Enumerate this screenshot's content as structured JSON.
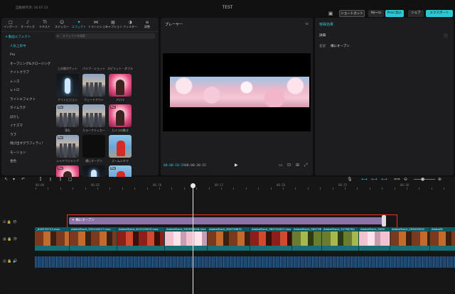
{
  "titlebar": {
    "autosave": "自動保存済: 16:07:13",
    "title": "TEST",
    "shortcut_label": "ショートカット",
    "user_label": "Ke~ra",
    "pro_label": "Proに加入",
    "share_label": "シェア",
    "export_label": "エクスポート"
  },
  "toolbar": {
    "tabs": [
      {
        "icon": "□",
        "label": "インポート"
      },
      {
        "icon": "♪",
        "label": "オーディオ"
      },
      {
        "icon": "TI",
        "label": "テキスト"
      },
      {
        "icon": "☺",
        "label": "ステッカー"
      },
      {
        "icon": "✦",
        "label": "エフェクト"
      },
      {
        "icon": "⋈",
        "label": "トランジション"
      },
      {
        "icon": "▤",
        "label": "キャプション"
      },
      {
        "icon": "◑",
        "label": "フィルター"
      },
      {
        "icon": "≡",
        "label": "調整"
      }
    ]
  },
  "sidebar": {
    "items": [
      {
        "label": "▾ 動画エフェクト"
      },
      {
        "label": "人気上昇中"
      },
      {
        "label": "Pro"
      },
      {
        "label": "オープニング&クロージング"
      },
      {
        "label": "ナイトクラブ"
      },
      {
        "label": "レンズ"
      },
      {
        "label": "レトロ"
      },
      {
        "label": "ライトエフェクト"
      },
      {
        "label": "タイムラグ"
      },
      {
        "label": "ぼかし"
      },
      {
        "label": "イナズマ"
      },
      {
        "label": "ラブ"
      },
      {
        "label": "飛び出すグラフィティ!"
      },
      {
        "label": "モーション"
      },
      {
        "label": "金色"
      }
    ]
  },
  "search": {
    "placeholder": "エフェクトを検索"
  },
  "effects": {
    "top_labels": [
      "三分割ポケット",
      "パイプ・ショット",
      "スピリット・ダブル"
    ],
    "grid": [
      {
        "label": "ナイトビジョン",
        "pro": "",
        "style": "t-dance"
      },
      {
        "label": "フェードアウト",
        "pro": "",
        "style": "t-city"
      },
      {
        "label": "アロマ",
        "pro": "",
        "style": "t-pink"
      },
      {
        "label": "落札",
        "pro": "Pro",
        "style": "t-city"
      },
      {
        "label": "カラーフリッカー",
        "pro": "",
        "style": "t-city"
      },
      {
        "label": "カメラの動き",
        "pro": "Pro",
        "style": "t-pink"
      },
      {
        "label": "シャドウジャンプ",
        "pro": "Pro",
        "style": "t-city"
      },
      {
        "label": "横にオープン",
        "pro": "",
        "style": "t-dark"
      },
      {
        "label": "ズームシネマ",
        "pro": "",
        "style": "t-red"
      },
      {
        "label": "",
        "pro": "Pro",
        "style": "t-pink"
      },
      {
        "label": "",
        "pro": "",
        "style": "t-dance"
      },
      {
        "label": "",
        "pro": "Pro",
        "style": "t-red"
      }
    ]
  },
  "player": {
    "title": "プレーヤー",
    "time_current": "00:00:10:29",
    "time_total": "00:00:30:22"
  },
  "details": {
    "header": "特殊効果",
    "section": "詳細",
    "name_key": "名前",
    "name_value": "横にオープン"
  },
  "timeline": {
    "ruler": [
      "00:00",
      "00:05",
      "00:10",
      "00:15",
      "00:20",
      "00:25",
      "00:30"
    ],
    "effect_label": "横にオープン",
    "clips": [
      {
        "name": "_640233713.mov",
        "style": "fr-food"
      },
      {
        "name": "AdobeStock_555416217.mov",
        "style": "fr-food"
      },
      {
        "name": "AdobeStock_612125953.mov",
        "style": "fr-red"
      },
      {
        "name": "AdobeStock_550935946.mov",
        "style": "fr-blossom"
      },
      {
        "name": "AdobeStock_626756631",
        "style": "fr-food"
      },
      {
        "name": "AdobeStock_589740427.mov",
        "style": "fr-red"
      },
      {
        "name": "AdobeStock_589738",
        "style": "fr-green"
      },
      {
        "name": "AdobeStock_51796784",
        "style": "fr-green"
      },
      {
        "name": "AdobeStock_5005",
        "style": "fr-blossom"
      },
      {
        "name": "AdobeStock_299030592",
        "style": "fr-food"
      },
      {
        "name": "AdobeSt",
        "style": "fr-food"
      }
    ]
  }
}
